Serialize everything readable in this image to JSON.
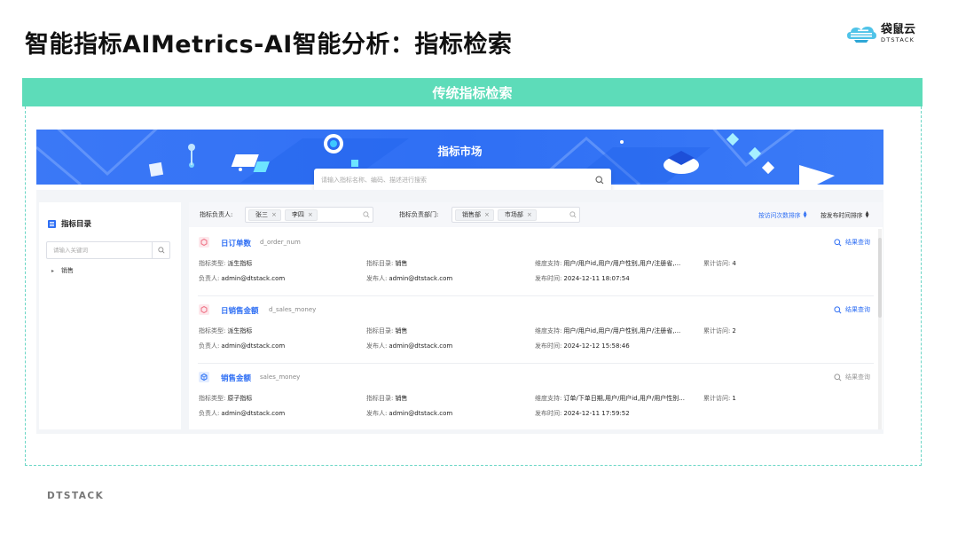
{
  "slide": {
    "title": "智能指标AIMetrics-AI智能分析：指标检索",
    "brand_cn": "袋鼠云",
    "brand_en": "DTSTACK",
    "banner": "传统指标检索",
    "footer": "DTSTACK"
  },
  "hero": {
    "title": "指标市场",
    "search_placeholder": "请输入指标名称、编码、描述进行搜索"
  },
  "sidebar": {
    "title": "指标目录",
    "search_placeholder": "请输入关键词",
    "tree": [
      {
        "label": "销售"
      }
    ]
  },
  "filters": {
    "owner_label": "指标负责人:",
    "owner_tags": [
      "张三",
      "李四"
    ],
    "dept_label": "指标负责部门:",
    "dept_tags": [
      "销售部",
      "市场部"
    ],
    "sort_visit": "按访问次数排序",
    "sort_publish": "按发布时间排序"
  },
  "cards": [
    {
      "name": "日订单数",
      "code": "d_order_num",
      "query": "结果查询",
      "query_enabled": true,
      "type_k": "指标类型:",
      "type_v": "派生指标",
      "cat_k": "指标目录:",
      "cat_v": "销售",
      "dim_k": "维度支持:",
      "dim_v": "用户/用户id,用户/用户性别,用户/注册省,...",
      "visit_k": "累计访问:",
      "visit_v": "4",
      "owner_k": "负责人:",
      "owner_v": "admin@dtstack.com",
      "pub_k": "发布人:",
      "pub_v": "admin@dtstack.com",
      "time_k": "发布时间:",
      "time_v": "2024-12-11 18:07:54"
    },
    {
      "name": "日销售金额",
      "code": "d_sales_money",
      "query": "结果查询",
      "query_enabled": true,
      "type_k": "指标类型:",
      "type_v": "派生指标",
      "cat_k": "指标目录:",
      "cat_v": "销售",
      "dim_k": "维度支持:",
      "dim_v": "用户/用户id,用户/用户性别,用户/注册省,...",
      "visit_k": "累计访问:",
      "visit_v": "2",
      "owner_k": "负责人:",
      "owner_v": "admin@dtstack.com",
      "pub_k": "发布人:",
      "pub_v": "admin@dtstack.com",
      "time_k": "发布时间:",
      "time_v": "2024-12-12 15:58:46"
    },
    {
      "name": "销售金额",
      "code": "sales_money",
      "query": "结果查询",
      "query_enabled": false,
      "type_k": "指标类型:",
      "type_v": "原子指标",
      "cat_k": "指标目录:",
      "cat_v": "销售",
      "dim_k": "维度支持:",
      "dim_v": "订单/下单日期,用户/用户id,用户/用户性别...",
      "visit_k": "累计访问:",
      "visit_v": "1",
      "owner_k": "负责人:",
      "owner_v": "admin@dtstack.com",
      "pub_k": "发布人:",
      "pub_v": "admin@dtstack.com",
      "time_k": "发布时间:",
      "time_v": "2024-12-11 17:59:52"
    }
  ],
  "colors": {
    "banner": "#5ddcb9",
    "primary": "#2f6ff4",
    "derived_icon": "#f07a8c",
    "atomic_icon": "#3d7df5"
  }
}
